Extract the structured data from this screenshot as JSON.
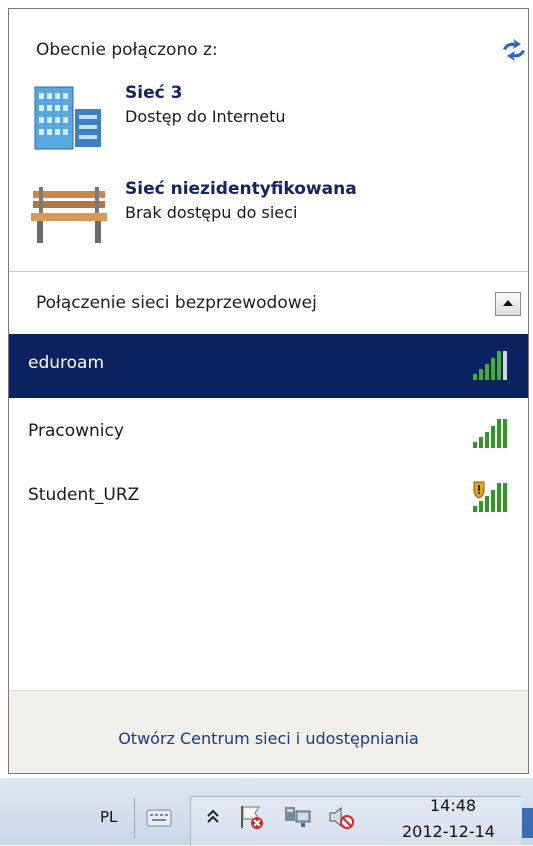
{
  "flyout": {
    "current_label": "Obecnie połączono z:",
    "refresh_icon": "refresh-arrows-icon",
    "networks": [
      {
        "name": "Sieć  3",
        "status": "Dostęp do Internetu",
        "icon": "domain-network-icon"
      },
      {
        "name": "Sieć niezidentyfikowana",
        "status": "Brak dostępu do sieci",
        "icon": "public-bench-network-icon"
      }
    ],
    "wifi_header": "Połączenie sieci bezprzewodowej",
    "collapse_icon": "collapse-up-icon",
    "wifi_list": [
      {
        "name": "eduroam",
        "selected": true,
        "signal_bars": 5,
        "secured_warning": false
      },
      {
        "name": "Pracownicy",
        "selected": false,
        "signal_bars": 5,
        "secured_warning": false
      },
      {
        "name": "Student_URZ",
        "selected": false,
        "signal_bars": 5,
        "secured_warning": true
      }
    ],
    "footer_link": "Otwórz Centrum sieci i udostępniania",
    "colors": {
      "selected_bg": "#0b2461",
      "network_name": "#14236b",
      "link": "#1a3a8f",
      "signal": "#2e9a25"
    }
  },
  "taskbar": {
    "language": "PL",
    "tray_icons": [
      "keyboard-icon",
      "show-hidden-icons-chevron-icon",
      "action-center-flag-error-icon",
      "network-monitor-icon",
      "volume-muted-icon"
    ],
    "clock_time": "14:48",
    "clock_date": "2012-12-14"
  }
}
